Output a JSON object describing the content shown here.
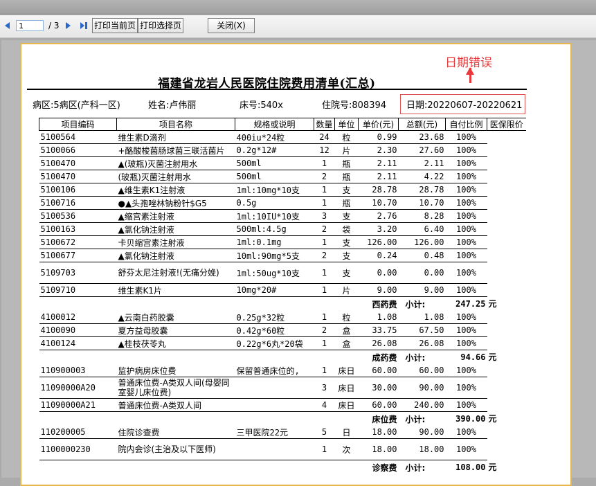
{
  "toolbar": {
    "page_input": "1",
    "page_total": "/ 3",
    "print_current": "打印当前页",
    "print_selected": "打印选择页",
    "close": "关闭(X)"
  },
  "annotation": {
    "text": "日期错误",
    "color": "#e8383a"
  },
  "document": {
    "title": "福建省龙岩人民医院住院费用清单(汇总)",
    "ward": "病区:5病区(产科一区)",
    "name": "姓名:卢伟丽",
    "bed": "床号:540x",
    "admission_no": "住院号:808394",
    "date": "日期:20220607-20220621"
  },
  "table": {
    "headers": [
      "项目编码",
      "项目名称",
      "规格或说明",
      "数量",
      "单位",
      "单价(元)",
      "总额(元)",
      "自付比例",
      "医保限价"
    ],
    "rows": [
      {
        "type": "item",
        "code": "5100564",
        "name": "维生素D滴剂",
        "spec": "400iu*24粒",
        "qty": "24",
        "unit": "粒",
        "price": "0.99",
        "total": "23.68",
        "ratio": "100%"
      },
      {
        "type": "item",
        "code": "5100066",
        "name": "+酪酸梭菌肠球菌三联活菌片",
        "spec": "0.2g*12#",
        "qty": "12",
        "unit": "片",
        "price": "2.30",
        "total": "27.60",
        "ratio": "100%"
      },
      {
        "type": "item",
        "code": "5100470",
        "name": "▲(玻瓶)灭菌注射用水",
        "spec": "500ml",
        "qty": "1",
        "unit": "瓶",
        "price": "2.11",
        "total": "2.11",
        "ratio": "100%"
      },
      {
        "type": "item",
        "code": "5100470",
        "name": "(玻瓶)灭菌注射用水",
        "spec": "500ml",
        "qty": "2",
        "unit": "瓶",
        "price": "2.11",
        "total": "4.22",
        "ratio": "100%"
      },
      {
        "type": "item",
        "code": "5100106",
        "name": "▲维生素K1注射液",
        "spec": "1ml:10mg*10支",
        "qty": "1",
        "unit": "支",
        "price": "28.78",
        "total": "28.78",
        "ratio": "100%"
      },
      {
        "type": "item",
        "code": "5100716",
        "name": "●▲头孢唑林钠粉针$G5",
        "spec": "0.5g",
        "qty": "1",
        "unit": "瓶",
        "price": "10.70",
        "total": "10.70",
        "ratio": "100%"
      },
      {
        "type": "item",
        "code": "5100536",
        "name": "▲缩宫素注射液",
        "spec": "1ml:10IU*10支",
        "qty": "3",
        "unit": "支",
        "price": "2.76",
        "total": "8.28",
        "ratio": "100%"
      },
      {
        "type": "item",
        "code": "5100163",
        "name": "▲氯化钠注射液",
        "spec": "500ml:4.5g",
        "qty": "2",
        "unit": "袋",
        "price": "3.20",
        "total": "6.40",
        "ratio": "100%"
      },
      {
        "type": "item",
        "code": "5100672",
        "name": "卡贝缩宫素注射液",
        "spec": "1ml:0.1mg",
        "qty": "1",
        "unit": "支",
        "price": "126.00",
        "total": "126.00",
        "ratio": "100%"
      },
      {
        "type": "item",
        "code": "5100677",
        "name": "▲氯化钠注射液",
        "spec": "10ml:90mg*5支",
        "qty": "2",
        "unit": "支",
        "price": "0.24",
        "total": "0.48",
        "ratio": "100%"
      },
      {
        "type": "item",
        "tall": true,
        "code": "5109703",
        "name": "舒芬太尼注射液!(无痛分娩)",
        "spec": "1ml:50ug*10支",
        "qty": "1",
        "unit": "支",
        "price": "0.00",
        "total": "0.00",
        "ratio": "100%"
      },
      {
        "type": "item",
        "code": "5109710",
        "name": "维生素K1片",
        "spec": "10mg*20#",
        "qty": "1",
        "unit": "片",
        "price": "9.00",
        "total": "9.00",
        "ratio": "100%"
      },
      {
        "type": "sub",
        "label": "西药费",
        "sub": "小计:",
        "amount": "247.25",
        "yuan": "元"
      },
      {
        "type": "item",
        "code": "4100012",
        "name": "▲云南白药胶囊",
        "spec": "0.25g*32粒",
        "qty": "1",
        "unit": "粒",
        "price": "1.08",
        "total": "1.08",
        "ratio": "100%"
      },
      {
        "type": "item",
        "code": "4100090",
        "name": "夏方益母胶囊",
        "spec": "0.42g*60粒",
        "qty": "2",
        "unit": "盒",
        "price": "33.75",
        "total": "67.50",
        "ratio": "100%"
      },
      {
        "type": "item",
        "code": "4100124",
        "name": "▲桂枝茯苓丸",
        "spec": "0.22g*6丸*20袋",
        "qty": "1",
        "unit": "盒",
        "price": "26.08",
        "total": "26.08",
        "ratio": "100%"
      },
      {
        "type": "sub",
        "label": "成药费",
        "sub": "小计:",
        "amount": "94.66",
        "yuan": "元"
      },
      {
        "type": "item",
        "code": "110900003",
        "name": "监护病房床位费",
        "spec": "保留普通床位的,",
        "qty": "1",
        "unit": "床日",
        "price": "60.00",
        "total": "60.00",
        "ratio": "100%"
      },
      {
        "type": "item",
        "tall": true,
        "code": "11090000A20",
        "name": "普通床位费-A类双人间(母婴同室婴儿床位费)",
        "spec": "",
        "qty": "3",
        "unit": "床日",
        "price": "30.00",
        "total": "90.00",
        "ratio": "100%"
      },
      {
        "type": "item",
        "code": "11090000A21",
        "name": "普通床位费-A类双人间",
        "spec": "",
        "qty": "4",
        "unit": "床日",
        "price": "60.00",
        "total": "240.00",
        "ratio": "100%"
      },
      {
        "type": "sub",
        "label": "床位费",
        "sub": "小计:",
        "amount": "390.00",
        "yuan": "元"
      },
      {
        "type": "item",
        "code": "110200005",
        "name": "住院诊查费",
        "spec": "三甲医院22元",
        "qty": "5",
        "unit": "日",
        "price": "18.00",
        "total": "90.00",
        "ratio": "100%"
      },
      {
        "type": "item",
        "tall": true,
        "code": "1100000230",
        "name": "院内会诊(主治及以下医师)",
        "spec": "",
        "qty": "1",
        "unit": "次",
        "price": "18.00",
        "total": "18.00",
        "ratio": "100%"
      },
      {
        "type": "sub",
        "label": "诊察费",
        "sub": "小计:",
        "amount": "108.00",
        "yuan": "元"
      }
    ]
  }
}
